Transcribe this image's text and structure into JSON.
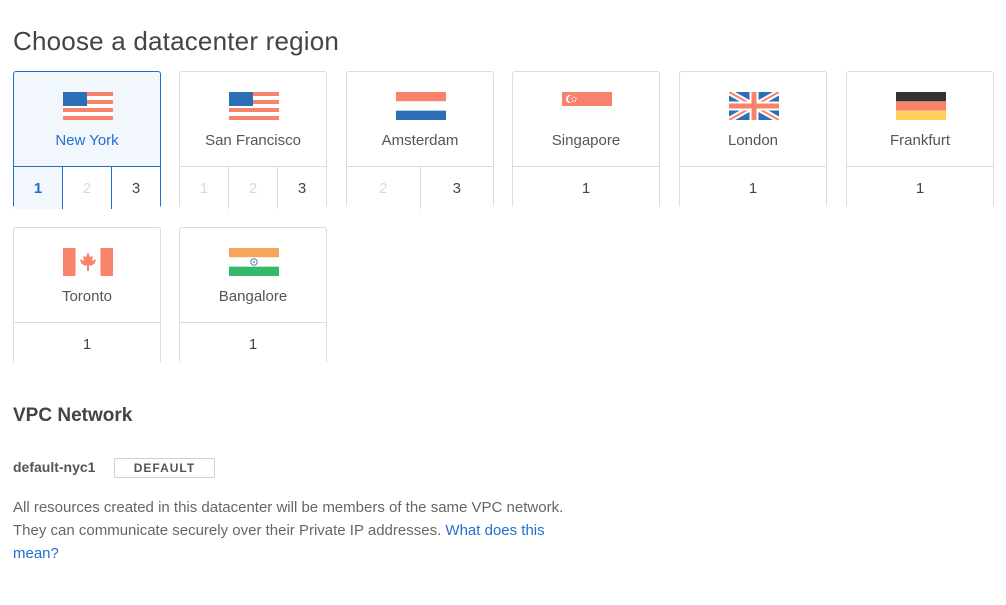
{
  "page": {
    "title": "Choose a datacenter region"
  },
  "regions": [
    {
      "name": "New York",
      "flag": "us-flag",
      "selected": true,
      "numbers": [
        {
          "label": "1",
          "state": "active"
        },
        {
          "label": "2",
          "state": "disabled"
        },
        {
          "label": "3",
          "state": "normal"
        }
      ]
    },
    {
      "name": "San Francisco",
      "flag": "us-flag",
      "selected": false,
      "numbers": [
        {
          "label": "1",
          "state": "disabled"
        },
        {
          "label": "2",
          "state": "disabled"
        },
        {
          "label": "3",
          "state": "normal"
        }
      ]
    },
    {
      "name": "Amsterdam",
      "flag": "nl-flag",
      "selected": false,
      "numbers": [
        {
          "label": "2",
          "state": "disabled"
        },
        {
          "label": "3",
          "state": "normal"
        }
      ]
    },
    {
      "name": "Singapore",
      "flag": "sg-flag",
      "selected": false,
      "numbers": [
        {
          "label": "1",
          "state": "normal"
        }
      ]
    },
    {
      "name": "London",
      "flag": "uk-flag",
      "selected": false,
      "numbers": [
        {
          "label": "1",
          "state": "normal"
        }
      ]
    },
    {
      "name": "Frankfurt",
      "flag": "de-flag",
      "selected": false,
      "numbers": [
        {
          "label": "1",
          "state": "normal"
        }
      ]
    },
    {
      "name": "Toronto",
      "flag": "ca-flag",
      "selected": false,
      "numbers": [
        {
          "label": "1",
          "state": "normal"
        }
      ]
    },
    {
      "name": "Bangalore",
      "flag": "in-flag",
      "selected": false,
      "numbers": [
        {
          "label": "1",
          "state": "normal"
        }
      ]
    }
  ],
  "vpc": {
    "title": "VPC Network",
    "name": "default-nyc1",
    "badge": "DEFAULT",
    "description": "All resources created in this datacenter will be members of the same VPC network. They can communicate securely over their Private IP addresses. ",
    "link": "What does this mean?"
  },
  "colors": {
    "accent": "#1f6fd0",
    "border": "#dcdcdc",
    "flag_red": "#f7836b",
    "flag_blue": "#2d6fb6"
  }
}
